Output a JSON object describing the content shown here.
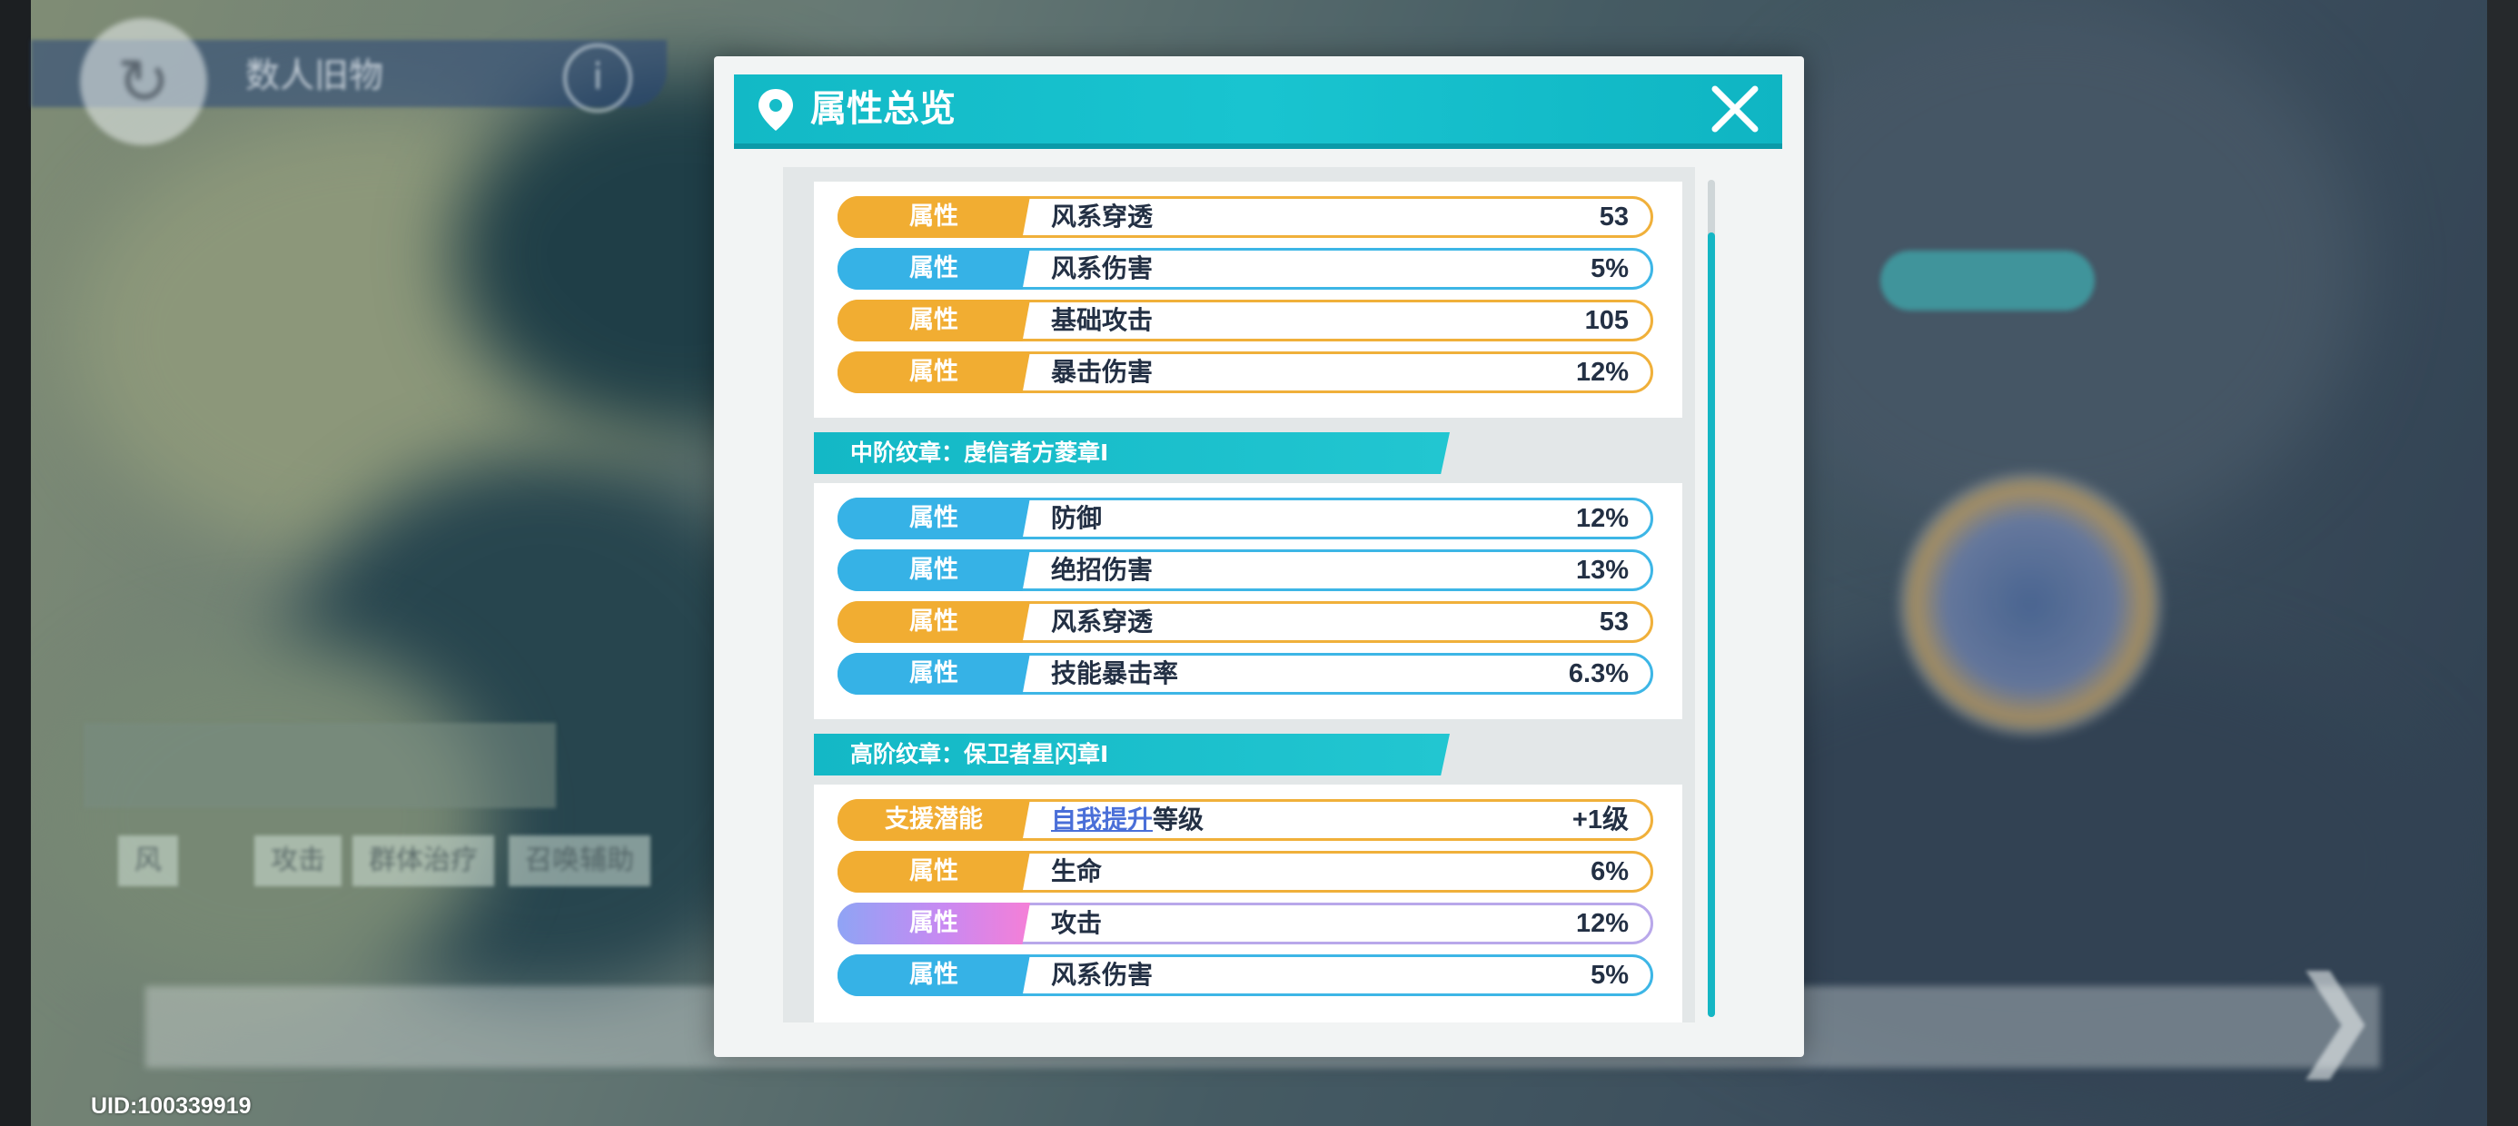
{
  "background": {
    "location_text": "数人旧物",
    "uid": "UID:100339919",
    "tags": [
      "风",
      "攻击",
      "群体治疗",
      "召唤辅助"
    ]
  },
  "modal": {
    "title": "属性总览",
    "icons": {
      "header": "map-pin-icon",
      "close": "close-icon"
    },
    "colors": {
      "teal": "#13b8c6",
      "orange": "#f1ad32",
      "blue": "#36b2e6"
    },
    "sections": [
      {
        "title": "",
        "rows": [
          {
            "tag": "属性",
            "name": "风系穿透",
            "value": "53",
            "color": "orange"
          },
          {
            "tag": "属性",
            "name": "风系伤害",
            "value": "5%",
            "color": "blue"
          },
          {
            "tag": "属性",
            "name": "基础攻击",
            "value": "105",
            "color": "orange"
          },
          {
            "tag": "属性",
            "name": "暴击伤害",
            "value": "12%",
            "color": "orange"
          }
        ]
      },
      {
        "title": "中阶纹章：虔信者方菱章Ⅰ",
        "rows": [
          {
            "tag": "属性",
            "name": "防御",
            "value": "12%",
            "color": "blue"
          },
          {
            "tag": "属性",
            "name": "绝招伤害",
            "value": "13%",
            "color": "blue"
          },
          {
            "tag": "属性",
            "name": "风系穿透",
            "value": "53",
            "color": "orange"
          },
          {
            "tag": "属性",
            "name": "技能暴击率",
            "value": "6.3%",
            "color": "blue"
          }
        ]
      },
      {
        "title": "高阶纹章：保卫者星闪章Ⅰ",
        "rows": [
          {
            "tag": "支援潜能",
            "name_link": "自我提升",
            "name_suffix": "等级",
            "value": "+1级",
            "color": "orange"
          },
          {
            "tag": "属性",
            "name": "生命",
            "value": "6%",
            "color": "orange"
          },
          {
            "tag": "属性",
            "name": "攻击",
            "value": "12%",
            "color": "purple"
          },
          {
            "tag": "属性",
            "name": "风系伤害",
            "value": "5%",
            "color": "blue"
          }
        ]
      }
    ]
  }
}
